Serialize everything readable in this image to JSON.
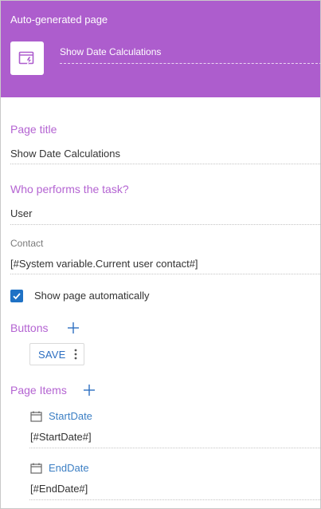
{
  "header": {
    "title": "Auto-generated page",
    "page_name": "Show Date Calculations",
    "icon": "page-icon"
  },
  "page_title": {
    "label": "Page title",
    "value": "Show Date Calculations"
  },
  "performer": {
    "label": "Who performs the task?",
    "value": "User"
  },
  "contact": {
    "label": "Contact",
    "value": "[#System variable.Current user contact#]"
  },
  "show_page": {
    "label": "Show page automatically",
    "checked": true
  },
  "buttons": {
    "label": "Buttons",
    "items": [
      {
        "label": "SAVE"
      }
    ]
  },
  "page_items": {
    "label": "Page Items",
    "items": [
      {
        "name": "StartDate",
        "value": "[#StartDate#]",
        "icon": "calendar-icon"
      },
      {
        "name": "EndDate",
        "value": "[#EndDate#]",
        "icon": "calendar-icon"
      }
    ]
  },
  "colors": {
    "header_bg": "#ad5dcd",
    "section_label": "#b464d2",
    "accent_blue": "#2d6fc1"
  }
}
